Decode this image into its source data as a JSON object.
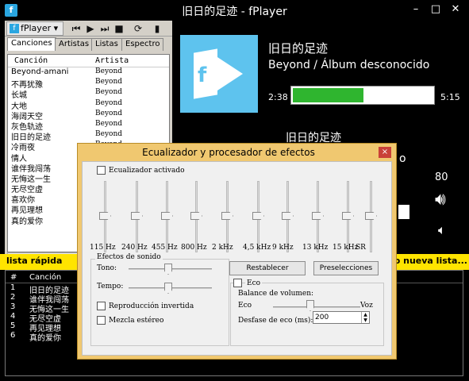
{
  "window": {
    "title": "旧日的足迹 - fPlayer",
    "app_icon_letter": "f"
  },
  "toolbar": {
    "app_label": "fPlayer",
    "prev_icon": "⏮",
    "play_icon": "▶",
    "next_icon": "⏭",
    "stop_icon": "■",
    "repeat_icon": "⟳",
    "eq_icon": "▮"
  },
  "tabs": [
    "Canciones",
    "Artistas",
    "Listas",
    "Espectro"
  ],
  "songs": {
    "col_song": "Canción",
    "col_artist": "Artista",
    "rows": [
      {
        "song": "Beyond-amani",
        "artist": "Beyond"
      },
      {
        "song": "不再犹豫",
        "artist": "Beyond"
      },
      {
        "song": "长城",
        "artist": "Beyond"
      },
      {
        "song": "大地",
        "artist": "Beyond"
      },
      {
        "song": "海阔天空",
        "artist": "Beyond"
      },
      {
        "song": "灰色轨迹",
        "artist": "Beyond"
      },
      {
        "song": "旧日的足迹",
        "artist": "Beyond"
      },
      {
        "song": "冷雨夜",
        "artist": "Beyond"
      },
      {
        "song": "情人",
        "artist": "Beyond"
      },
      {
        "song": "谁伴我闯荡",
        "artist": "Beyond"
      },
      {
        "song": "无悔这一生",
        "artist": "Beyond"
      },
      {
        "song": "无尽空虚",
        "artist": "Beyond"
      },
      {
        "song": "喜欢你",
        "artist": "Beyond"
      },
      {
        "song": "再见理想",
        "artist": "Beyond"
      },
      {
        "song": "真的爱你",
        "artist": "Beyond"
      }
    ]
  },
  "now_playing": {
    "title": "旧日的足迹",
    "artist_album": "Beyond / Álbum desconocido",
    "current_time": "2:38",
    "total_time": "5:15",
    "progress_fraction": 0.5,
    "big_title": "旧日的足迹",
    "partial_char": "o",
    "volume": "80"
  },
  "quick_list": {
    "label": "lista rápida",
    "new_list_label": "o nueva lista...",
    "col_num": "#",
    "col_song": "Canción",
    "rows": [
      {
        "n": "1",
        "song": "旧日的足迹"
      },
      {
        "n": "2",
        "song": "谁伴我闯荡"
      },
      {
        "n": "3",
        "song": "无悔这一生"
      },
      {
        "n": "4",
        "song": "无尽空虚"
      },
      {
        "n": "5",
        "song": "再见理想"
      },
      {
        "n": "6",
        "song": "真的爱你"
      }
    ]
  },
  "eq_dialog": {
    "title": "Ecualizador y procesador de efectos",
    "close": "×",
    "enable_label": "Ecualizador activado",
    "bands": [
      "115 Hz",
      "240 Hz",
      "455 Hz",
      "800 Hz",
      "2 kHz",
      "4,5 kHz",
      "9 kHz",
      "13 kHz",
      "15 kHz",
      "SR"
    ],
    "effects_group": "Efectos de sonido",
    "tone_label": "Tono:",
    "tempo_label": "Tempo:",
    "reverse_label": "Reproducción invertida",
    "stereo_label": "Mezcla estéreo",
    "reset_button": "Restablecer",
    "presets_button": "Preselecciones",
    "echo_label": "Eco",
    "balance_label": "Balance de volumen:",
    "echo_side": "Eco",
    "voice_side": "Voz",
    "echo_delay_label": "Desfase de eco (ms):",
    "echo_delay_value": "200"
  },
  "colors": {
    "accent_green": "#2fb52f",
    "quick_bar": "#ffe400",
    "cover_blue": "#5ec3ee",
    "dialog_frame": "#f0c870"
  }
}
